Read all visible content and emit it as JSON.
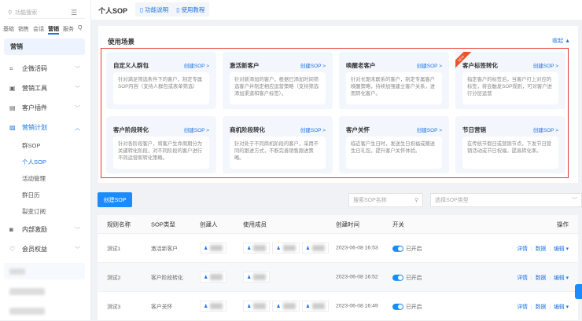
{
  "sidebar": {
    "search_placeholder": "功能搜索",
    "tabs": [
      "基础",
      "销售",
      "会话",
      "营销",
      "服务",
      "Q"
    ],
    "section": "营销",
    "items": [
      {
        "label": "企微活码"
      },
      {
        "label": "营销工具"
      },
      {
        "label": "客户插件"
      },
      {
        "label": "营销计划"
      },
      {
        "label": "内部激励"
      },
      {
        "label": "会员权益"
      }
    ],
    "subitems": [
      "群SOP",
      "个人SOP",
      "活动管理",
      "群日历",
      "裂变订阅"
    ]
  },
  "header": {
    "title": "个人SOP",
    "link1": "功能说明",
    "link2": "使用教程"
  },
  "scenes": {
    "title": "使用场景",
    "collapse": "收起 ▲",
    "create_label": "创建SOP >",
    "new_badge": "NEW",
    "cards": [
      {
        "title": "自定义人群包",
        "desc": "针对满足筛选条件下的客户，制定专属SOP内容（支持人群包或表单筛选）"
      },
      {
        "title": "激活新客户",
        "desc": "针对新添加的客户，根据已添加时间筛选客户并制定相应运营策略（支持筛选添加渠道和客户标签）。"
      },
      {
        "title": "唤醒老客户",
        "desc": "针对长期未联系的客户，制定专属客户唤醒策略，持续加强建立客户关系，进而转化客户。"
      },
      {
        "title": "客户标签转化",
        "desc": "指定客户的标签后，当客户打上对应的标签，将会触发SOP规则，可对客户进行分层运营"
      },
      {
        "title": "客户阶段转化",
        "desc": "针对各阶段客户，将客户生命周期分为关键转化阶段，对不同阶段的客户进行不同运营和转化策略。"
      },
      {
        "title": "商机阶段转化",
        "desc": "针对处于不同商机阶段的客户，采用不同的跟进方式，不断完善销售跟进策略。"
      },
      {
        "title": "客户关怀",
        "desc": "临近客户生日时，发送生日祝福或赠送生日礼包，提升客户关怀体验。"
      },
      {
        "title": "节日营销",
        "desc": "在传统节假日或营销节点，下发节日营销活动或节日祝福，提高转化率。"
      }
    ]
  },
  "toolbar": {
    "create": "创建SOP",
    "search_placeholder": "搜索SOP名称",
    "type_placeholder": "选择SOP类型"
  },
  "table": {
    "headers": [
      "规则名称",
      "SOP类型",
      "创建人",
      "使用成员",
      "创建时间",
      "开关",
      "操作"
    ],
    "rows": [
      {
        "name": "测试1",
        "type": "激活新客户",
        "time": "2023-06-08 16:53",
        "status": "已开启"
      },
      {
        "name": "测试2",
        "type": "客户阶段转化",
        "time": "2023-06-08 16:52",
        "status": "已开启"
      },
      {
        "name": "测试3",
        "type": "客户关怀",
        "time": "2023-06-08 16:49",
        "status": "已开启"
      }
    ],
    "actions": [
      "详情",
      "数据",
      "编辑 ▾"
    ]
  }
}
